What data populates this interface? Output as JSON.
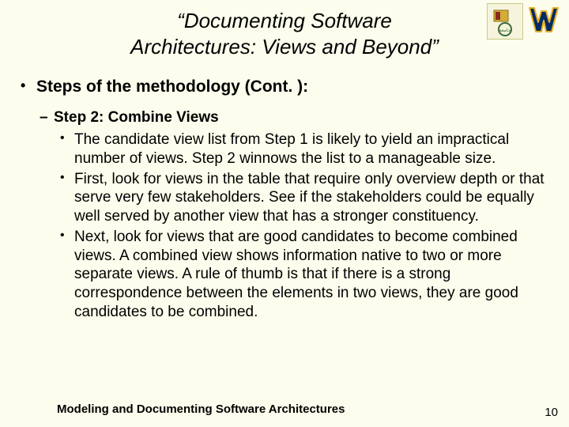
{
  "title_line1": "“Documenting Software",
  "title_line2": "Architectures: Views and Beyond”",
  "heading": "Steps of the methodology (Cont. ):",
  "step_label": "Step 2: Combine Views",
  "bullets": [
    "The candidate view list from Step 1 is likely to yield an impractical number of views. Step 2 winnows the list to a manageable size.",
    "First, look for views in the table that require only overview depth or that serve very few stakeholders. See if the stakeholders could be equally well served by another view that has a stronger constituency.",
    "Next, look for views that are good candidates to become combined views. A combined view shows information native to two or more separate views. A rule of thumb is that if there is a strong correspondence between the elements in two views, they are good candidates to be combined."
  ],
  "footer": "Modeling and Documenting Software Architectures",
  "page_number": "10"
}
